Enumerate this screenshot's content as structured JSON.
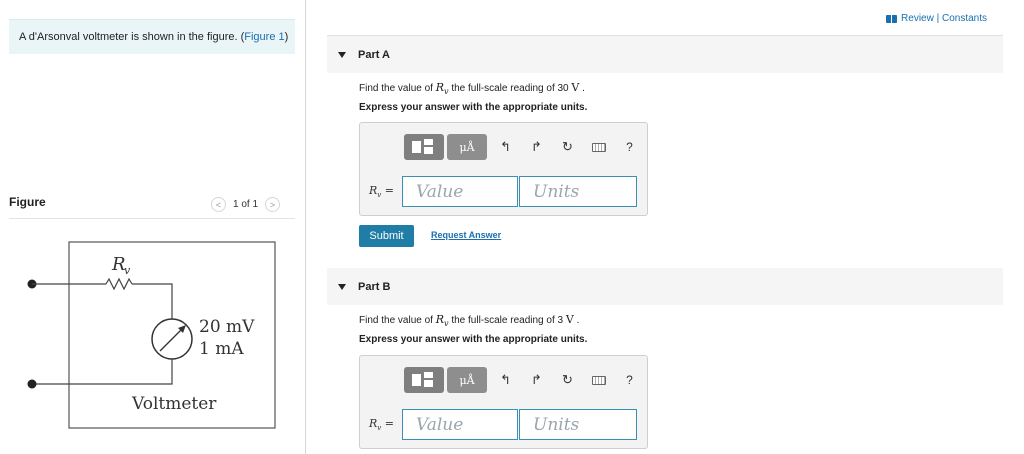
{
  "intro": {
    "text": "A d'Arsonval voltmeter is shown in the figure. (",
    "figure_link": "Figure 1",
    "close": ")"
  },
  "header": {
    "review_constants": "Review | Constants"
  },
  "figure": {
    "label": "Figure",
    "pager": "1 of 1",
    "prev_icon": "chevron-left-icon",
    "next_icon": "chevron-right-icon",
    "circuit": {
      "resistor_label": "R",
      "resistor_subscript": "v",
      "meter_voltage": "20 mV",
      "meter_current": "1 mA",
      "caption": "Voltmeter"
    }
  },
  "parts": [
    {
      "title": "Part A",
      "question_prefix": "Find the value of ",
      "symbol": "R",
      "symbol_sub": "v",
      "question_suffix": " the full-scale reading of 30 ",
      "unit": "V",
      "end": " .",
      "instruction": "Express your answer with the appropriate units.",
      "toolbar": {
        "templates_icon": "templates-icon",
        "units_button": "μÅ",
        "undo_icon": "undo-icon",
        "redo_icon": "redo-icon",
        "reset_icon": "reset-icon",
        "keyboard_icon": "keyboard-icon",
        "help": "?"
      },
      "answer_label": "R",
      "answer_label_sub": "v",
      "answer_eq": " =",
      "value_placeholder": "Value",
      "units_placeholder": "Units",
      "submit": "Submit",
      "request_answer": "Request Answer"
    },
    {
      "title": "Part B",
      "question_prefix": "Find the value of ",
      "symbol": "R",
      "symbol_sub": "v",
      "question_suffix": " the full-scale reading of 3 ",
      "unit": "V",
      "end": " .",
      "instruction": "Express your answer with the appropriate units.",
      "toolbar": {
        "templates_icon": "templates-icon",
        "units_button": "μÅ",
        "undo_icon": "undo-icon",
        "redo_icon": "redo-icon",
        "reset_icon": "reset-icon",
        "keyboard_icon": "keyboard-icon",
        "help": "?"
      },
      "answer_label": "R",
      "answer_label_sub": "v",
      "answer_eq": " =",
      "value_placeholder": "Value",
      "units_placeholder": "Units"
    }
  ],
  "colors": {
    "accent_link": "#1a6fae",
    "submit_bg": "#1f7da6",
    "intro_bg": "#eaf5f7",
    "field_border": "#3a8fb5"
  }
}
